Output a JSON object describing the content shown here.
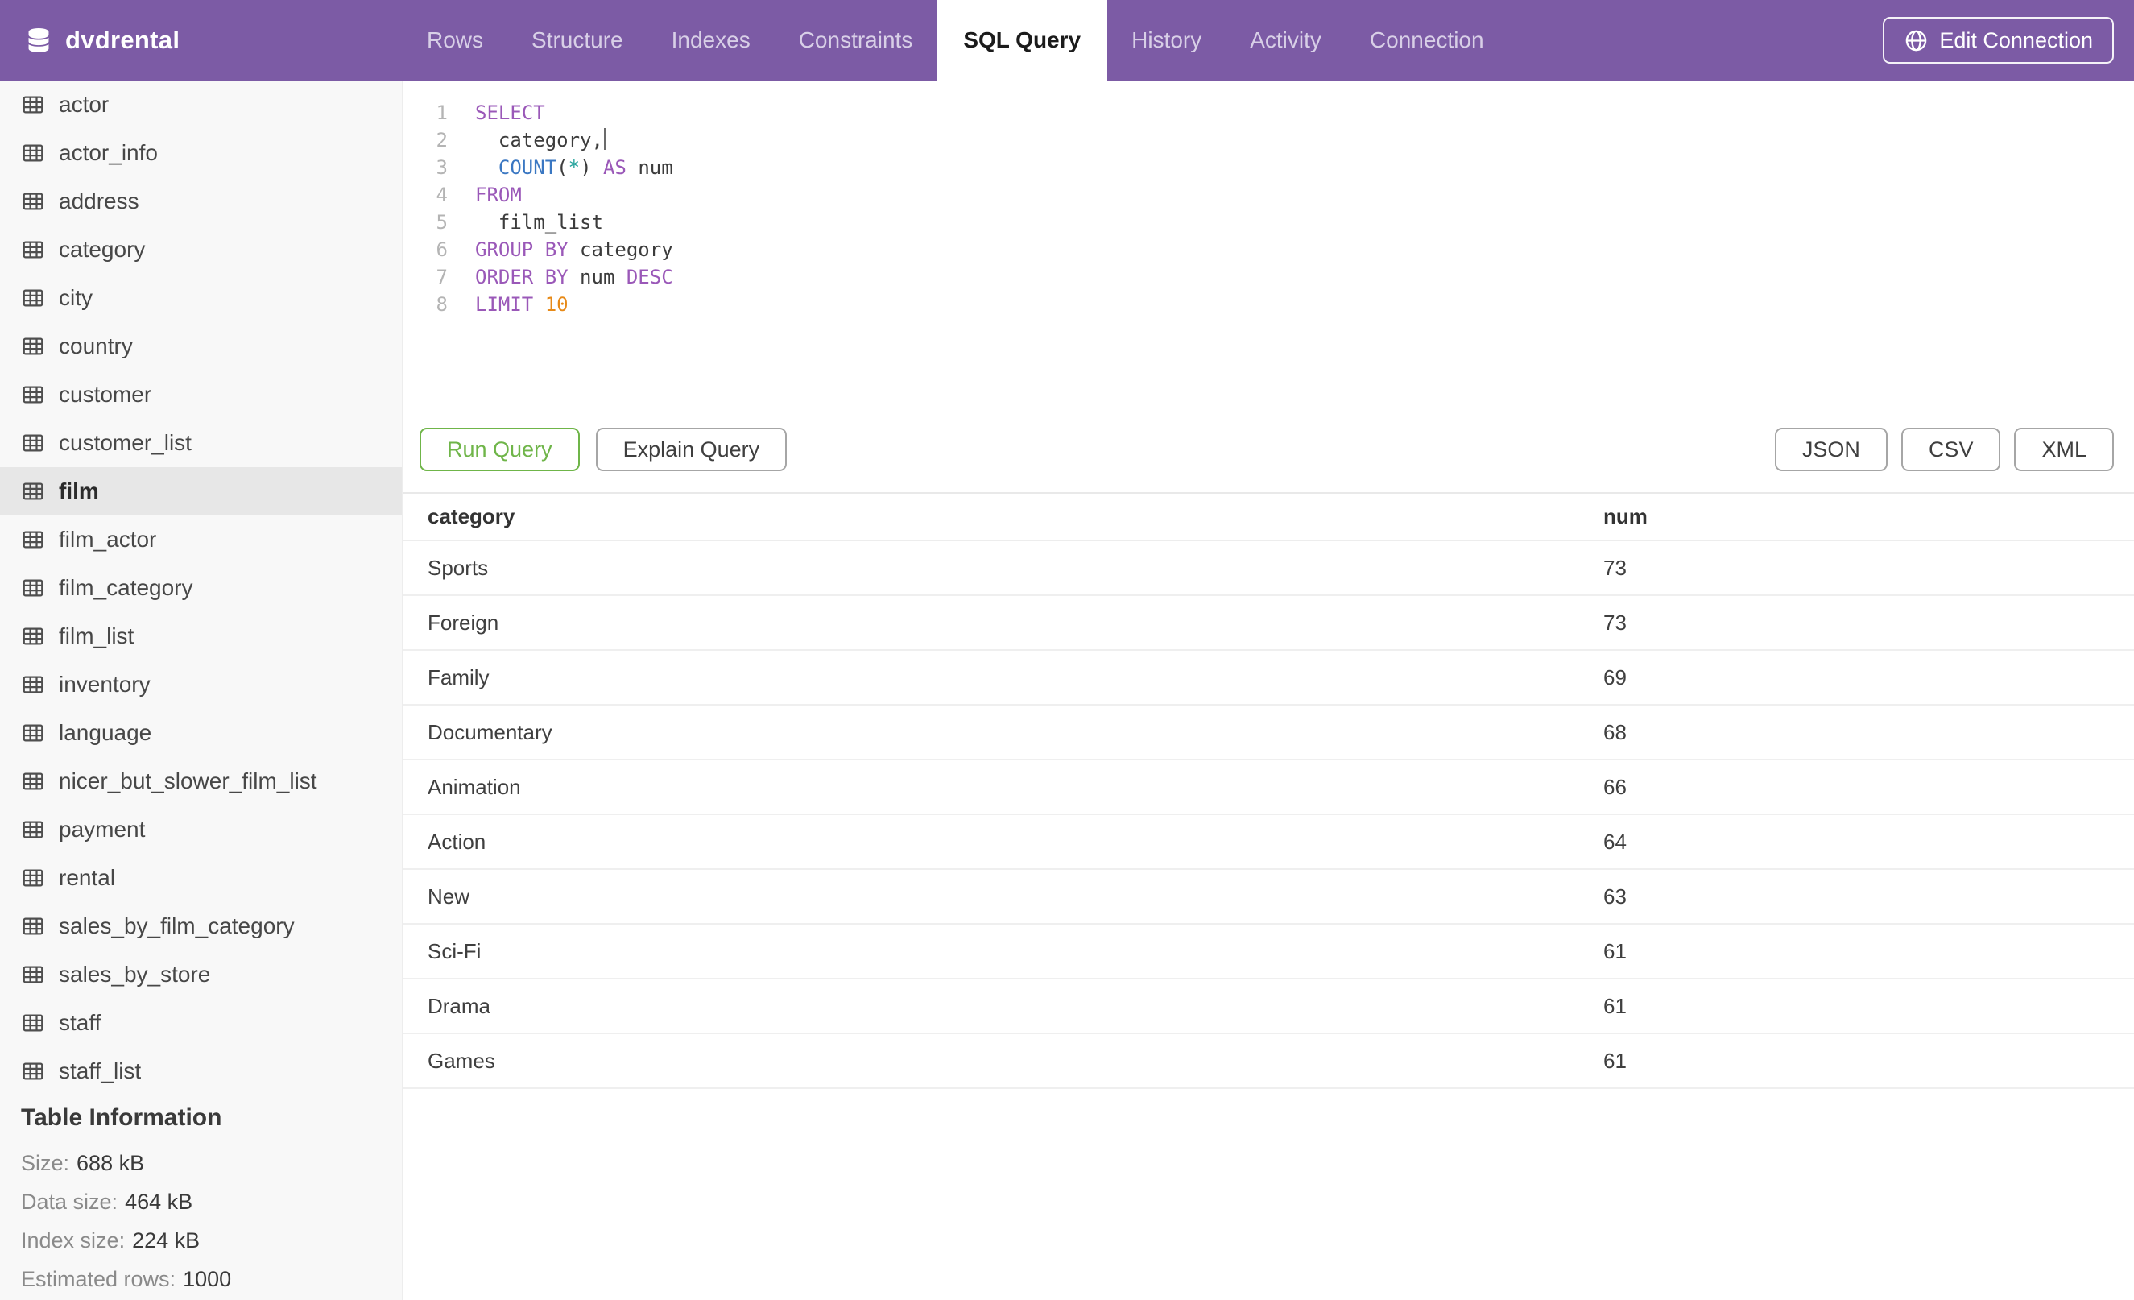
{
  "header": {
    "brand": "dvdrental",
    "tabs": [
      {
        "label": "Rows",
        "active": false
      },
      {
        "label": "Structure",
        "active": false
      },
      {
        "label": "Indexes",
        "active": false
      },
      {
        "label": "Constraints",
        "active": false
      },
      {
        "label": "SQL Query",
        "active": true
      },
      {
        "label": "History",
        "active": false
      },
      {
        "label": "Activity",
        "active": false
      },
      {
        "label": "Connection",
        "active": false
      }
    ],
    "edit_connection_label": "Edit Connection"
  },
  "sidebar": {
    "tables": [
      "actor",
      "actor_info",
      "address",
      "category",
      "city",
      "country",
      "customer",
      "customer_list",
      "film",
      "film_actor",
      "film_category",
      "film_list",
      "inventory",
      "language",
      "nicer_but_slower_film_list",
      "payment",
      "rental",
      "sales_by_film_category",
      "sales_by_store",
      "staff",
      "staff_list"
    ],
    "selected_table": "film",
    "table_information": {
      "heading": "Table Information",
      "stats": [
        {
          "label": "Size:",
          "value": "688 kB"
        },
        {
          "label": "Data size:",
          "value": "464 kB"
        },
        {
          "label": "Index size:",
          "value": "224 kB"
        },
        {
          "label": "Estimated rows:",
          "value": "1000"
        }
      ]
    }
  },
  "editor": {
    "lines": [
      {
        "n": "1",
        "tokens": [
          [
            "kw",
            "SELECT"
          ]
        ]
      },
      {
        "n": "2",
        "tokens": [
          [
            "tx",
            "  category,"
          ],
          [
            "caret",
            ""
          ]
        ]
      },
      {
        "n": "3",
        "tokens": [
          [
            "tx",
            "  "
          ],
          [
            "fn",
            "COUNT"
          ],
          [
            "tx",
            "("
          ],
          [
            "op",
            "*"
          ],
          [
            "tx",
            ") "
          ],
          [
            "kw",
            "AS"
          ],
          [
            "tx",
            " num"
          ]
        ]
      },
      {
        "n": "4",
        "tokens": [
          [
            "kw",
            "FROM"
          ]
        ]
      },
      {
        "n": "5",
        "tokens": [
          [
            "tx",
            "  film_list"
          ]
        ]
      },
      {
        "n": "6",
        "tokens": [
          [
            "kw",
            "GROUP BY"
          ],
          [
            "tx",
            " category"
          ]
        ]
      },
      {
        "n": "7",
        "tokens": [
          [
            "kw",
            "ORDER BY"
          ],
          [
            "tx",
            " num "
          ],
          [
            "kw",
            "DESC"
          ]
        ]
      },
      {
        "n": "8",
        "tokens": [
          [
            "kw",
            "LIMIT"
          ],
          [
            "nm",
            " 10"
          ]
        ]
      }
    ]
  },
  "actions": {
    "run_label": "Run Query",
    "explain_label": "Explain Query",
    "export_formats": [
      "JSON",
      "CSV",
      "XML"
    ]
  },
  "results": {
    "columns": [
      "category",
      "num"
    ],
    "rows": [
      [
        "Sports",
        "73"
      ],
      [
        "Foreign",
        "73"
      ],
      [
        "Family",
        "69"
      ],
      [
        "Documentary",
        "68"
      ],
      [
        "Animation",
        "66"
      ],
      [
        "Action",
        "64"
      ],
      [
        "New",
        "63"
      ],
      [
        "Sci-Fi",
        "61"
      ],
      [
        "Drama",
        "61"
      ],
      [
        "Games",
        "61"
      ]
    ]
  },
  "colors": {
    "nav_purple": "#7C5BA5",
    "run_green": "#6FB549",
    "keyword_purple": "#9A58B8",
    "function_blue": "#3A77C2",
    "operator_teal": "#23A29B",
    "number_orange": "#E78A18",
    "sidebar_bg": "#F8F8F8",
    "selected_row_bg": "#E7E7E7"
  }
}
